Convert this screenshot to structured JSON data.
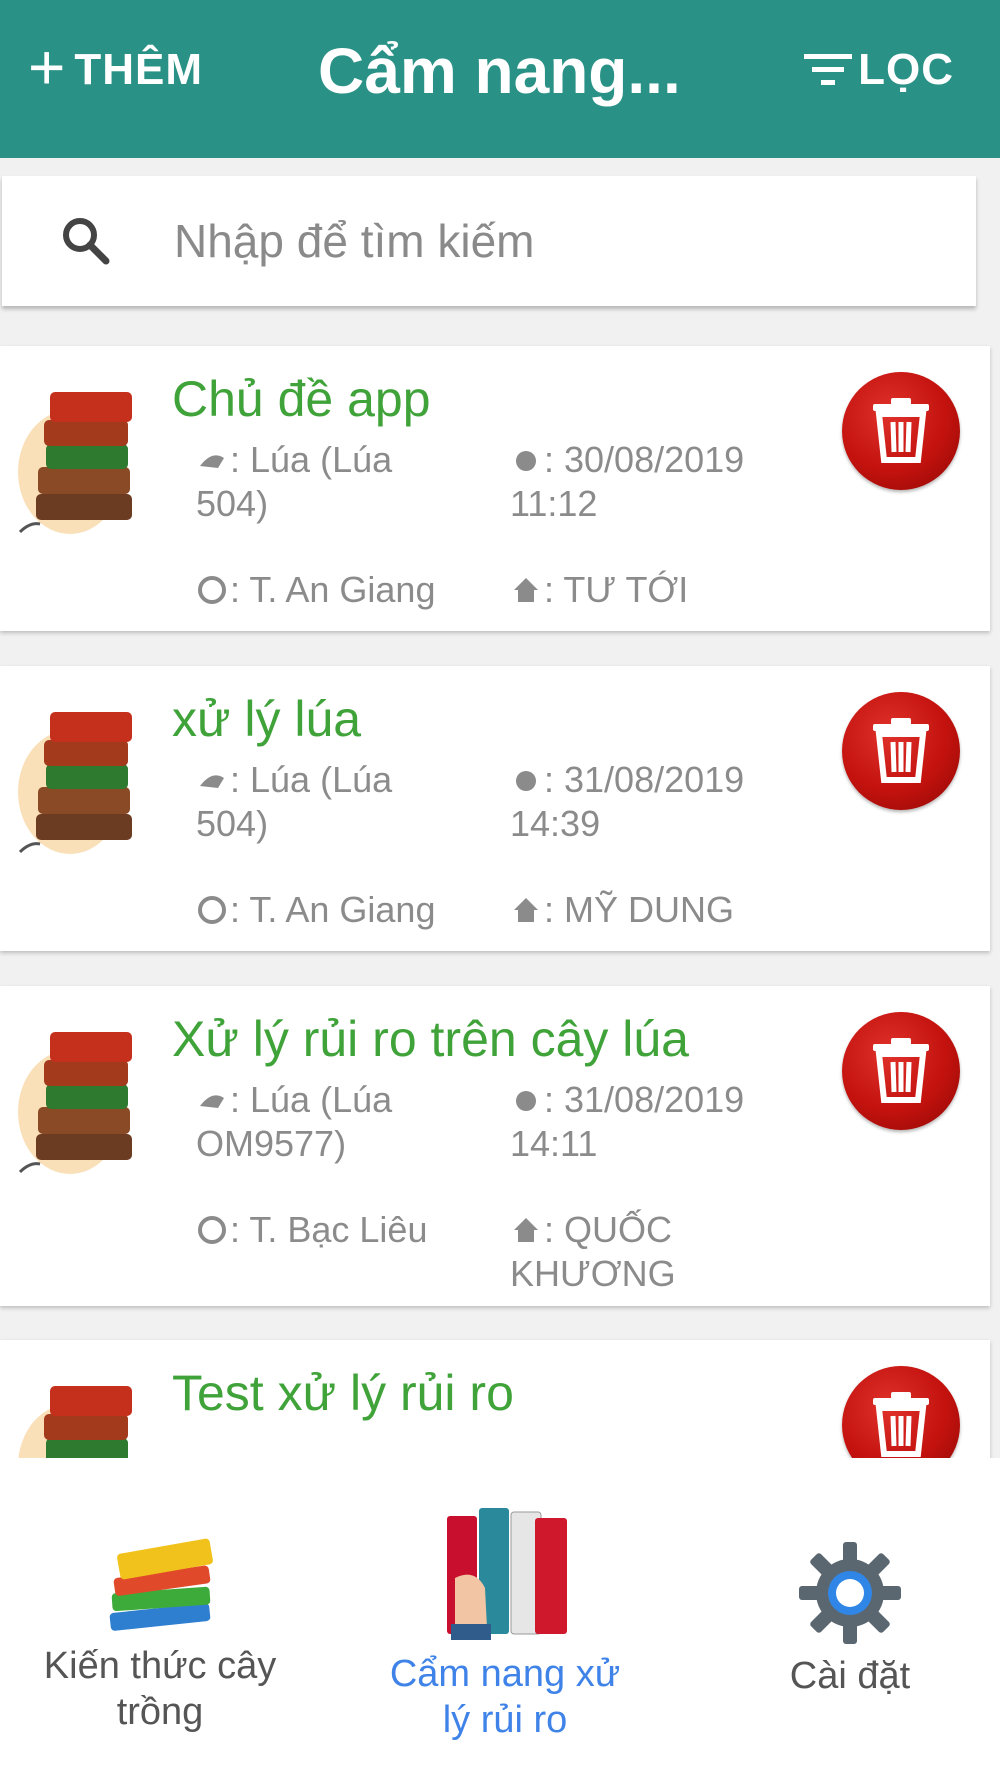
{
  "header": {
    "add_label": "THÊM",
    "title": "Cẩm nang...",
    "filter_label": "LỌC",
    "bg_color": "#2a9186"
  },
  "search": {
    "placeholder": "Nhập để tìm kiếm",
    "value": ""
  },
  "items": [
    {
      "title": "Chủ đề app",
      "crop": "Lúa (Lúa 504)",
      "datetime": "30/08/2019 11:12",
      "province": "T. An Giang",
      "farm": "TƯ TỚI"
    },
    {
      "title": "xử lý lúa",
      "crop": "Lúa (Lúa 504)",
      "datetime": "31/08/2019 14:39",
      "province": "T. An Giang",
      "farm": "MỸ DUNG"
    },
    {
      "title": "Xử lý rủi ro trên cây lúa",
      "crop": "Lúa (Lúa OM9577)",
      "datetime": "31/08/2019 14:11",
      "province": "T. Bạc Liêu",
      "farm": "QUỐC KHƯƠNG"
    },
    {
      "title": "Test xử lý rủi ro"
    }
  ],
  "bottom_nav": {
    "tabs": [
      {
        "label": "Kiến thức cây trồng",
        "icon": "books-icon",
        "active": false
      },
      {
        "label": "Cẩm nang xử lý rủi ro",
        "icon": "handbook-icon",
        "active": true
      },
      {
        "label": "Cài đặt",
        "icon": "gear-icon",
        "active": false
      }
    ],
    "active_color": "#3f83e8"
  },
  "colors": {
    "title_green": "#3fa33a",
    "delete_red": "#c3120e"
  }
}
